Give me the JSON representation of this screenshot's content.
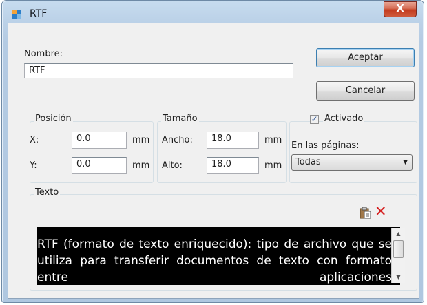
{
  "window": {
    "title": "RTF",
    "close_label": "X"
  },
  "nombre": {
    "label": "Nombre:",
    "value": "RTF"
  },
  "buttons": {
    "accept": "Aceptar",
    "cancel": "Cancelar"
  },
  "posicion": {
    "legend": "Posición",
    "x_label": "X:",
    "x_value": "0.0",
    "x_unit": "mm",
    "y_label": "Y:",
    "y_value": "0.0",
    "y_unit": "mm"
  },
  "tamano": {
    "legend": "Tamaño",
    "ancho_label": "Ancho:",
    "ancho_value": "18.0",
    "ancho_unit": "mm",
    "alto_label": "Alto:",
    "alto_value": "18.0",
    "alto_unit": "mm"
  },
  "activado": {
    "label": "Activado",
    "checked": true
  },
  "pages": {
    "label": "En las páginas:",
    "selected": "Todas"
  },
  "texto": {
    "legend": "Texto",
    "content": "RTF (formato de texto enriquecido): tipo de archivo que se utiliza para transferir documentos de texto con formato entre aplicaciones"
  },
  "colors": {
    "textbox_bg": "#000000",
    "delete_icon": "#d51f1f"
  },
  "icons": {
    "paste": "paste-icon",
    "delete": "delete-icon"
  }
}
